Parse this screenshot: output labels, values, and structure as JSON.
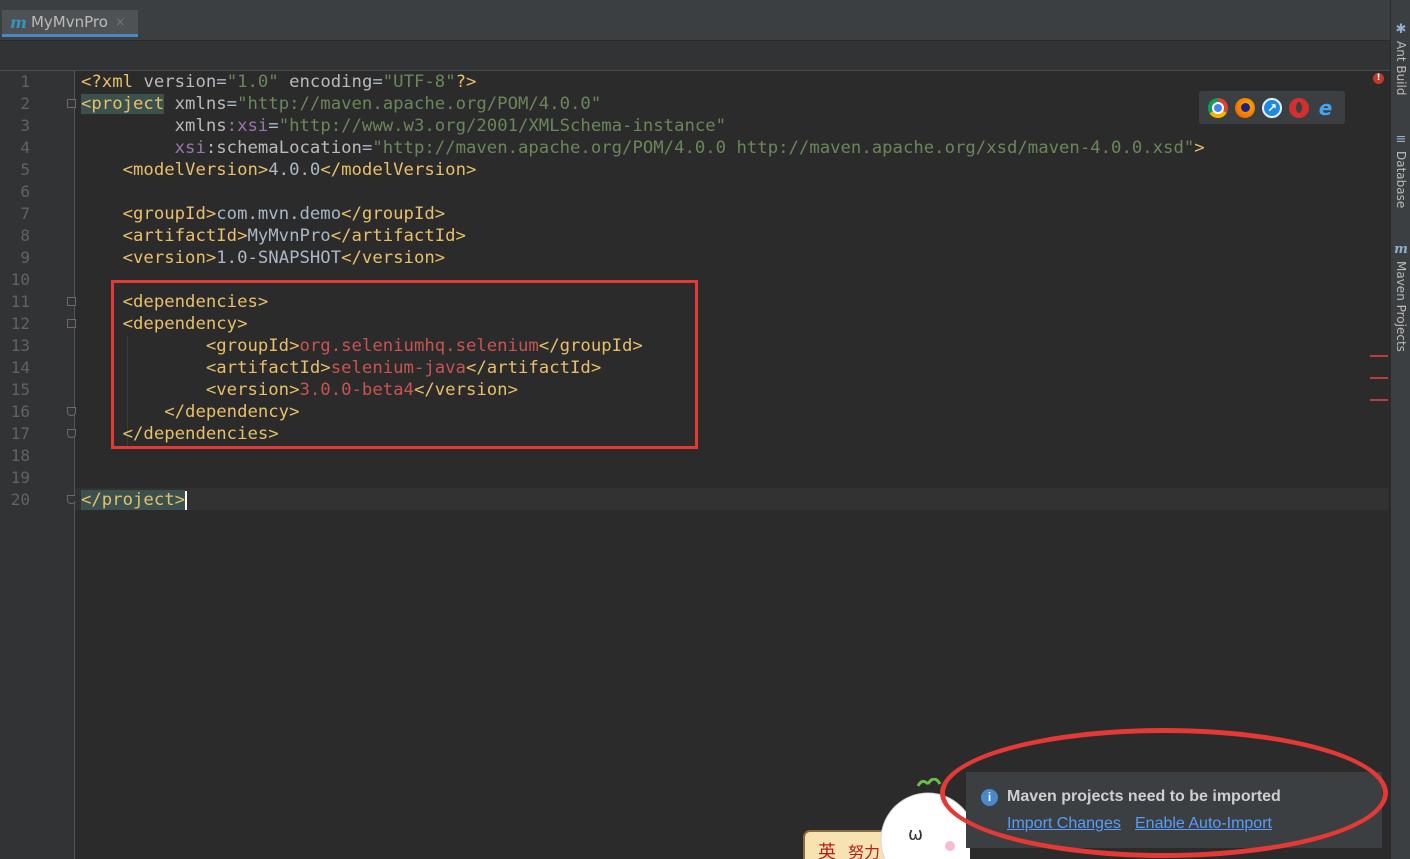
{
  "editor": {
    "tab": {
      "label": "MyMvnPro",
      "close": "×"
    },
    "line_numbers": [
      "1",
      "2",
      "3",
      "4",
      "5",
      "6",
      "7",
      "8",
      "9",
      "10",
      "11",
      "12",
      "13",
      "14",
      "15",
      "16",
      "17",
      "18",
      "19",
      "20"
    ],
    "code": {
      "l1_a": "<?xml ",
      "l1_b": "version",
      "l1_c": "=",
      "l1_d": "\"1.0\"",
      "l1_e": " encoding",
      "l1_f": "=",
      "l1_g": "\"UTF-8\"",
      "l1_h": "?>",
      "l2_a": "<project",
      "l2_b": " xmlns",
      "l2_c": "=",
      "l2_d": "\"http://maven.apache.org/POM/4.0.0\"",
      "l3_a": "         xmlns",
      "l3_b": ":xsi",
      "l3_c": "=",
      "l3_d": "\"http://www.w3.org/2001/XMLSchema-instance\"",
      "l4_a": "         xsi",
      "l4_b": ":schemaLocation",
      "l4_c": "=",
      "l4_d": "\"http://maven.apache.org/POM/4.0.0 http://maven.apache.org/xsd/maven-4.0.0.xsd\"",
      "l4_e": ">",
      "l5_a": "    <modelVersion>",
      "l5_b": "4.0.0",
      "l5_c": "</modelVersion>",
      "l7_a": "    <groupId>",
      "l7_b": "com.mvn.demo",
      "l7_c": "</groupId>",
      "l8_a": "    <artifactId>",
      "l8_b": "MyMvnPro",
      "l8_c": "</artifactId>",
      "l9_a": "    <version>",
      "l9_b": "1.0-SNAPSHOT",
      "l9_c": "</version>",
      "l11_a": "    <dependencies>",
      "l12_a": "    <dependency>",
      "l13_a": "            <groupId>",
      "l13_b": "org.seleniumhq.selenium",
      "l13_c": "</groupId>",
      "l14_a": "            <artifactId>",
      "l14_b": "selenium-java",
      "l14_c": "</artifactId>",
      "l15_a": "            <version>",
      "l15_b": "3.0.0-beta4",
      "l15_c": "</version>",
      "l16_a": "        </dependency>",
      "l17_a": "    </dependencies>",
      "l20_a": "</project>"
    }
  },
  "browser_icons": [
    "chrome-icon",
    "firefox-icon",
    "safari-icon",
    "opera-icon",
    "ie-icon"
  ],
  "right_toolwindows": [
    {
      "label": "Ant Build"
    },
    {
      "label": "Database"
    },
    {
      "label": "Maven Projects"
    }
  ],
  "notification": {
    "title": "Maven projects need to be imported",
    "action_import": "Import Changes",
    "action_auto": "Enable Auto-Import"
  },
  "sticker": {
    "text1": "英",
    "text2": "努力",
    "face": "ω"
  },
  "colors": {
    "background": "#2b2b2b",
    "tag": "#e8bf6a",
    "attr_value": "#6a8759",
    "namespace": "#9876aa",
    "changed_text": "#c75450",
    "annotation": "#e53935",
    "link": "#589df6"
  }
}
